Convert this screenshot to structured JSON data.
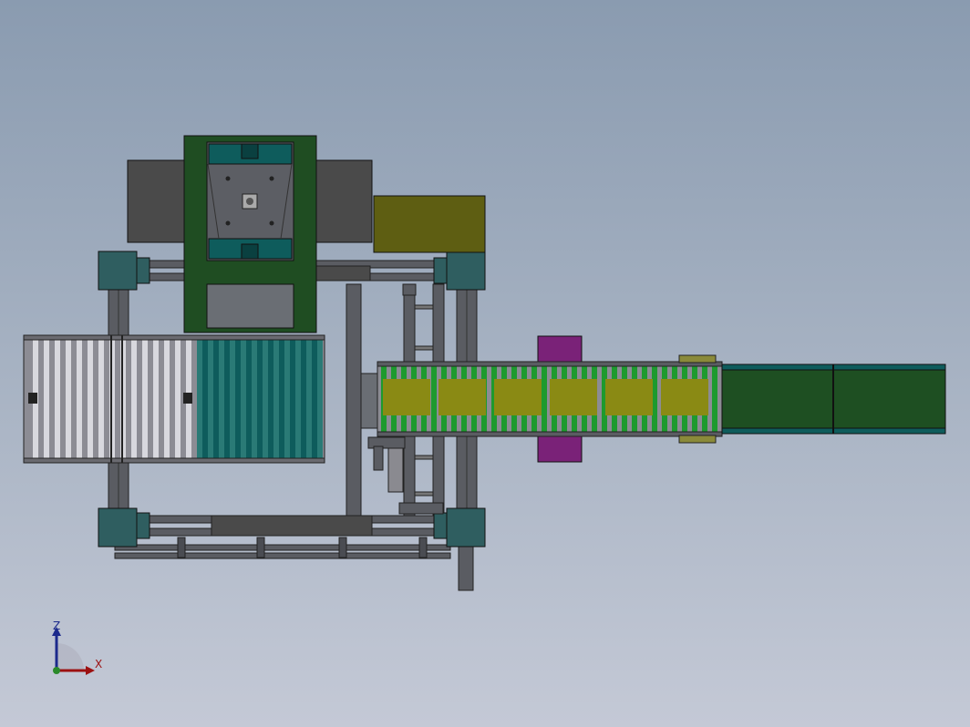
{
  "window": {
    "background_top": "#8a9bb0",
    "background_bottom": "#c4c9d6"
  },
  "colors": {
    "frame_green": "#1f4d22",
    "teal_block": "#0e5c5c",
    "corner_plate": "#2f5e60",
    "dark_gray": "#4a4a4a",
    "olive_box": "#5e5e12",
    "purple_guide": "#7a2278",
    "belt_green": "#1e4f22",
    "roller_green": "#1d9a2e",
    "roller_yellow": "#8a8a14",
    "roller_gray": "#8c8c94",
    "rail_gray": "#5a5c62"
  },
  "triad": {
    "z_label": "Z",
    "x_label": "X",
    "z_color": "#1c2a8c",
    "x_color": "#9c1010"
  }
}
